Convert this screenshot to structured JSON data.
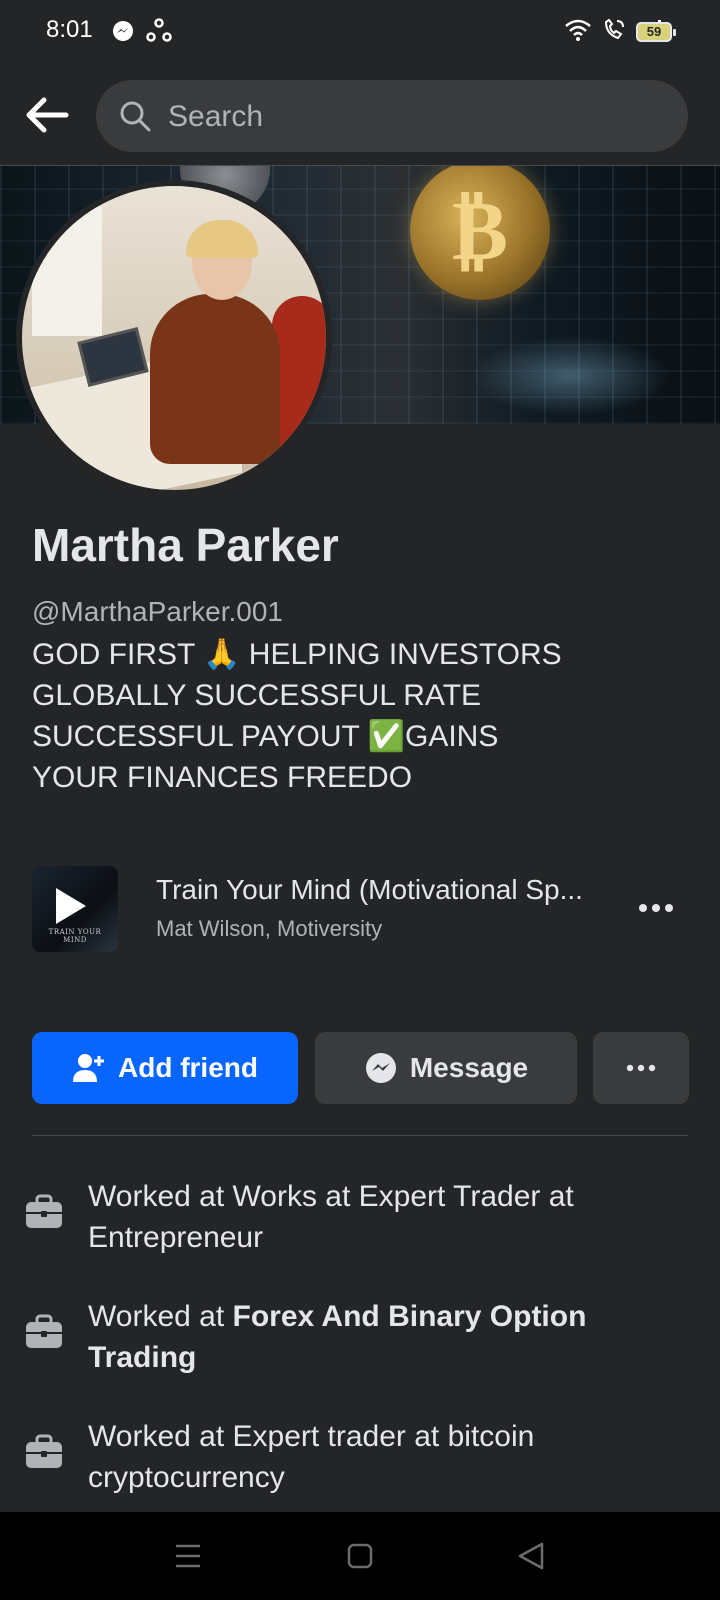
{
  "status_bar": {
    "time": "8:01",
    "battery": "59",
    "left_icons": [
      "messenger-icon",
      "sync-icon"
    ],
    "right_icons": [
      "wifi-icon",
      "wifi-call-icon",
      "signal-icon",
      "battery-icon"
    ]
  },
  "search": {
    "placeholder": "Search"
  },
  "profile": {
    "name": "Martha Parker",
    "handle": "@MarthaParker.001",
    "bio": "GOD FIRST 🙏 HELPING INVESTORS\nGLOBALLY SUCCESSFUL RATE\nSUCCESSFUL PAYOUT ✅GAINS\nYOUR FINANCES FREEDO"
  },
  "music": {
    "title": "Train Your Mind (Motivational Sp...",
    "artist": "Mat Wilson, Motiversity",
    "cover_text": "TRAIN YOUR MIND"
  },
  "actions": {
    "add_friend": "Add friend",
    "message": "Message",
    "more": "..."
  },
  "work": [
    {
      "prefix": "Worked at Works at Expert Trader at Entrepreneur",
      "bold": ""
    },
    {
      "prefix": "Worked at ",
      "bold": "Forex And Binary Option Trading"
    },
    {
      "prefix": "Worked at Expert trader at bitcoin cryptocurrency",
      "bold": ""
    }
  ],
  "colors": {
    "background": "#242526",
    "primary_button": "#0866ff",
    "secondary_button": "#3a3b3c",
    "text_primary": "#e4e6eb",
    "text_secondary": "#b0b3b8"
  }
}
